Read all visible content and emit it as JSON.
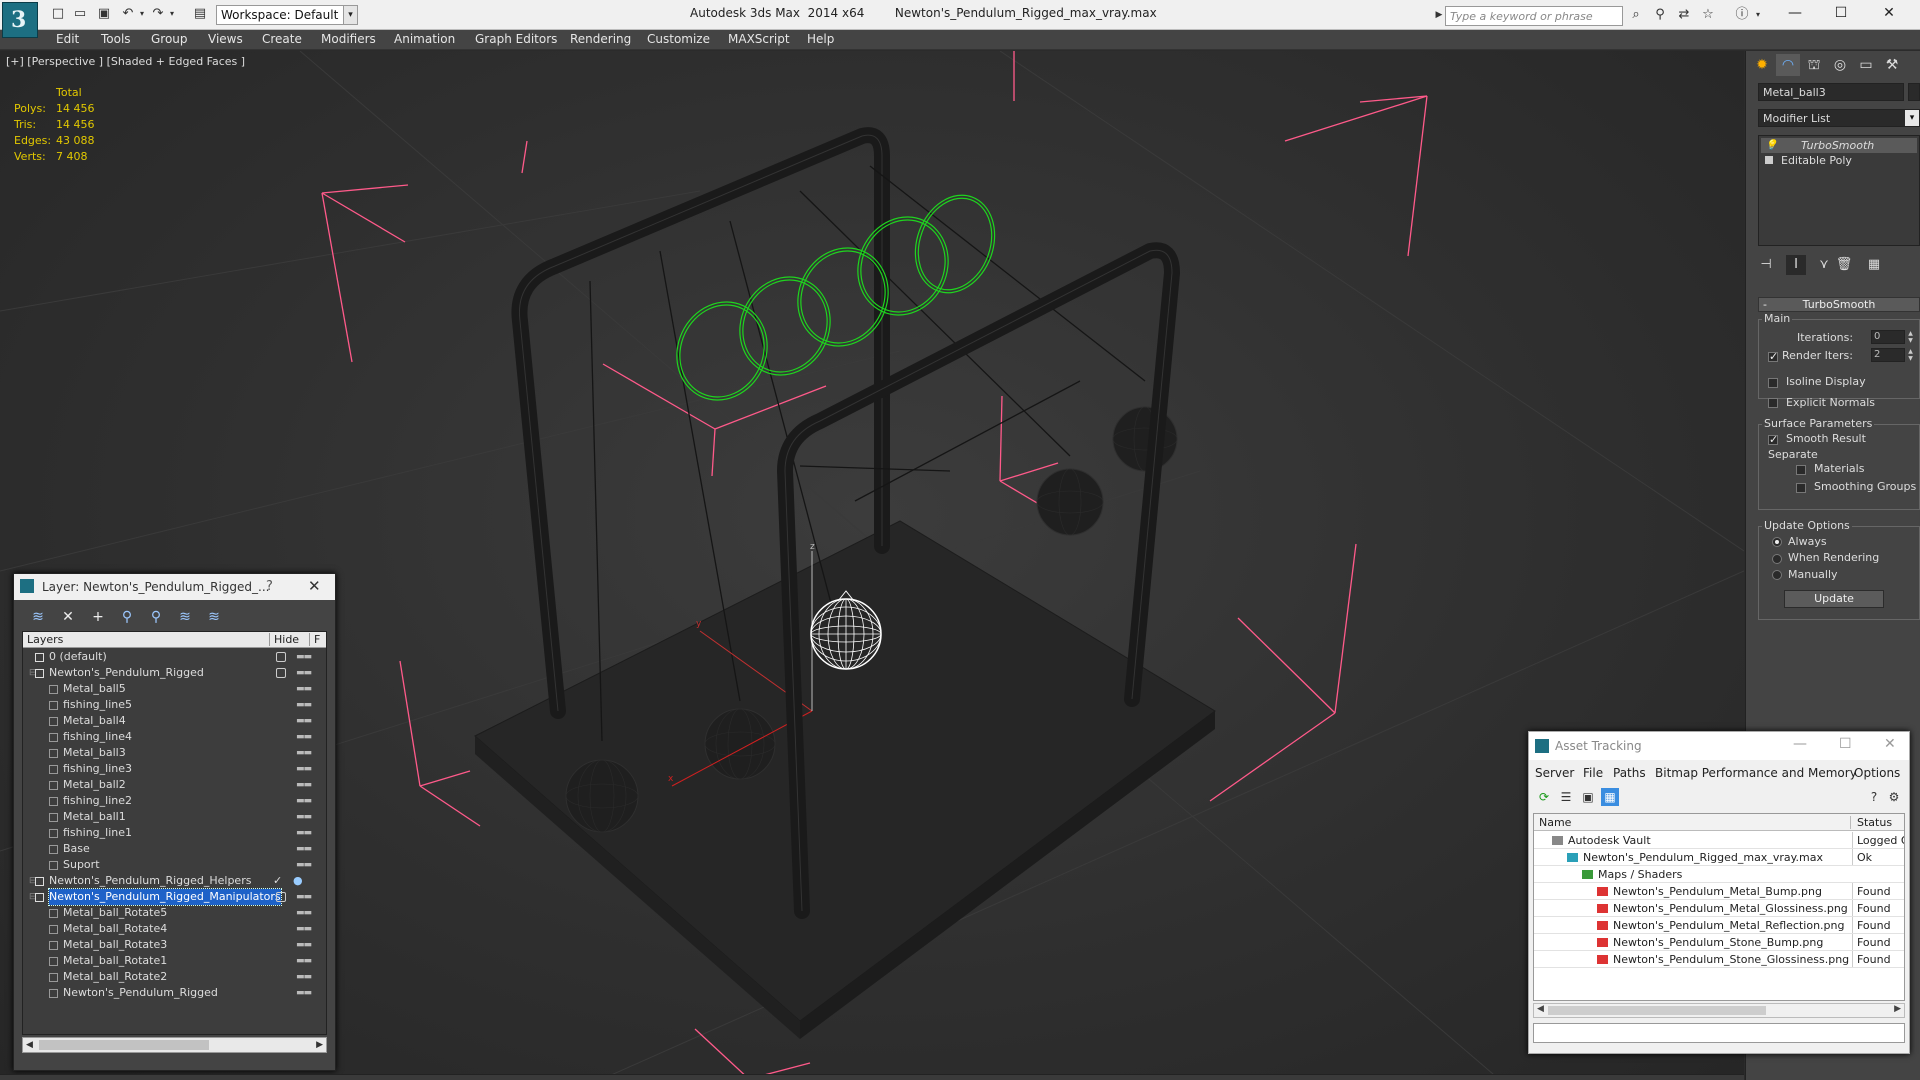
{
  "titlebar": {
    "app_title": "Autodesk 3ds Max  2014 x64",
    "file_title": "Newton's_Pendulum_Rigged_max_vray.max",
    "workspace": "Workspace: Default",
    "search_placeholder": "Type a keyword or phrase"
  },
  "menu": [
    "Edit",
    "Tools",
    "Group",
    "Views",
    "Create",
    "Modifiers",
    "Animation",
    "Graph Editors",
    "Rendering",
    "Customize",
    "MAXScript",
    "Help"
  ],
  "viewport": {
    "label": "[+] [Perspective ] [Shaded + Edged Faces ]",
    "stats_header": "Total",
    "stats": [
      {
        "label": "Polys:",
        "value": "14 456"
      },
      {
        "label": "Tris:",
        "value": "14 456"
      },
      {
        "label": "Edges:",
        "value": "43 088"
      },
      {
        "label": "Verts:",
        "value": "7 408"
      }
    ],
    "colors": {
      "bbox": "#ff5a8a",
      "helper": "#1fd41f",
      "object": "#1d1d1d",
      "selected": "#ffffff"
    }
  },
  "command_panel": {
    "object_name": "Metal_ball3",
    "modifier_list": "Modifier List",
    "stack": [
      "TurboSmooth",
      "Editable Poly"
    ],
    "rollout": "TurboSmooth",
    "main_group": "Main",
    "iterations_label": "Iterations:",
    "iterations_value": "0",
    "render_iters_label": "Render Iters:",
    "render_iters_value": "2",
    "isoline": "Isoline Display",
    "explicit_normals": "Explicit Normals",
    "surface_group": "Surface Parameters",
    "smooth_result": "Smooth Result",
    "separate": "Separate",
    "materials": "Materials",
    "smoothing_groups": "Smoothing Groups",
    "update_group": "Update Options",
    "always": "Always",
    "when_rendering": "When Rendering",
    "manually": "Manually",
    "update_button": "Update"
  },
  "layer_dialog": {
    "title": "Layer: Newton's_Pendulum_Rigged_...",
    "help": "?",
    "col_layers": "Layers",
    "col_hide": "Hide",
    "col_f": "F",
    "rows": [
      {
        "name": "0 (default)",
        "level": 0,
        "type": "layer"
      },
      {
        "name": "Newton's_Pendulum_Rigged",
        "level": 0,
        "type": "layer"
      },
      {
        "name": "Metal_ball5",
        "level": 1,
        "type": "object"
      },
      {
        "name": "fishing_line5",
        "level": 1,
        "type": "object"
      },
      {
        "name": "Metal_ball4",
        "level": 1,
        "type": "object"
      },
      {
        "name": "fishing_line4",
        "level": 1,
        "type": "object"
      },
      {
        "name": "Metal_ball3",
        "level": 1,
        "type": "object"
      },
      {
        "name": "fishing_line3",
        "level": 1,
        "type": "object"
      },
      {
        "name": "Metal_ball2",
        "level": 1,
        "type": "object"
      },
      {
        "name": "fishing_line2",
        "level": 1,
        "type": "object"
      },
      {
        "name": "Metal_ball1",
        "level": 1,
        "type": "object"
      },
      {
        "name": "fishing_line1",
        "level": 1,
        "type": "object"
      },
      {
        "name": "Base",
        "level": 1,
        "type": "object"
      },
      {
        "name": "Suport",
        "level": 1,
        "type": "object"
      },
      {
        "name": "Newton's_Pendulum_Rigged_Helpers",
        "level": 0,
        "type": "layer"
      },
      {
        "name": "Newton's_Pendulum_Rigged_Manipulators",
        "level": 0,
        "type": "layer"
      },
      {
        "name": "Metal_ball_Rotate5",
        "level": 1,
        "type": "object"
      },
      {
        "name": "Metal_ball_Rotate4",
        "level": 1,
        "type": "object"
      },
      {
        "name": "Metal_ball_Rotate3",
        "level": 1,
        "type": "object"
      },
      {
        "name": "Metal_ball_Rotate1",
        "level": 1,
        "type": "object"
      },
      {
        "name": "Metal_ball_Rotate2",
        "level": 1,
        "type": "object"
      },
      {
        "name": "Newton's_Pendulum_Rigged",
        "level": 1,
        "type": "object"
      }
    ]
  },
  "asset_dialog": {
    "title": "Asset Tracking",
    "menu": [
      "Server",
      "File",
      "Paths",
      "Bitmap Performance and Memory",
      "Options"
    ],
    "col_name": "Name",
    "col_status": "Status",
    "rows": [
      {
        "name": "Autodesk Vault",
        "status": "Logged Out",
        "level": 0,
        "icon": "vault"
      },
      {
        "name": "Newton's_Pendulum_Rigged_max_vray.max",
        "status": "Ok",
        "level": 1,
        "icon": "max"
      },
      {
        "name": "Maps / Shaders",
        "status": "",
        "level": 2,
        "icon": "maps"
      },
      {
        "name": "Newton's_Pendulum_Metal_Bump.png",
        "status": "Found",
        "level": 3,
        "icon": "png"
      },
      {
        "name": "Newton's_Pendulum_Metal_Glossiness.png",
        "status": "Found",
        "level": 3,
        "icon": "png"
      },
      {
        "name": "Newton's_Pendulum_Metal_Reflection.png",
        "status": "Found",
        "level": 3,
        "icon": "png"
      },
      {
        "name": "Newton's_Pendulum_Stone_Bump.png",
        "status": "Found",
        "level": 3,
        "icon": "png"
      },
      {
        "name": "Newton's_Pendulum_Stone_Glossiness.png",
        "status": "Found",
        "level": 3,
        "icon": "png"
      }
    ]
  }
}
